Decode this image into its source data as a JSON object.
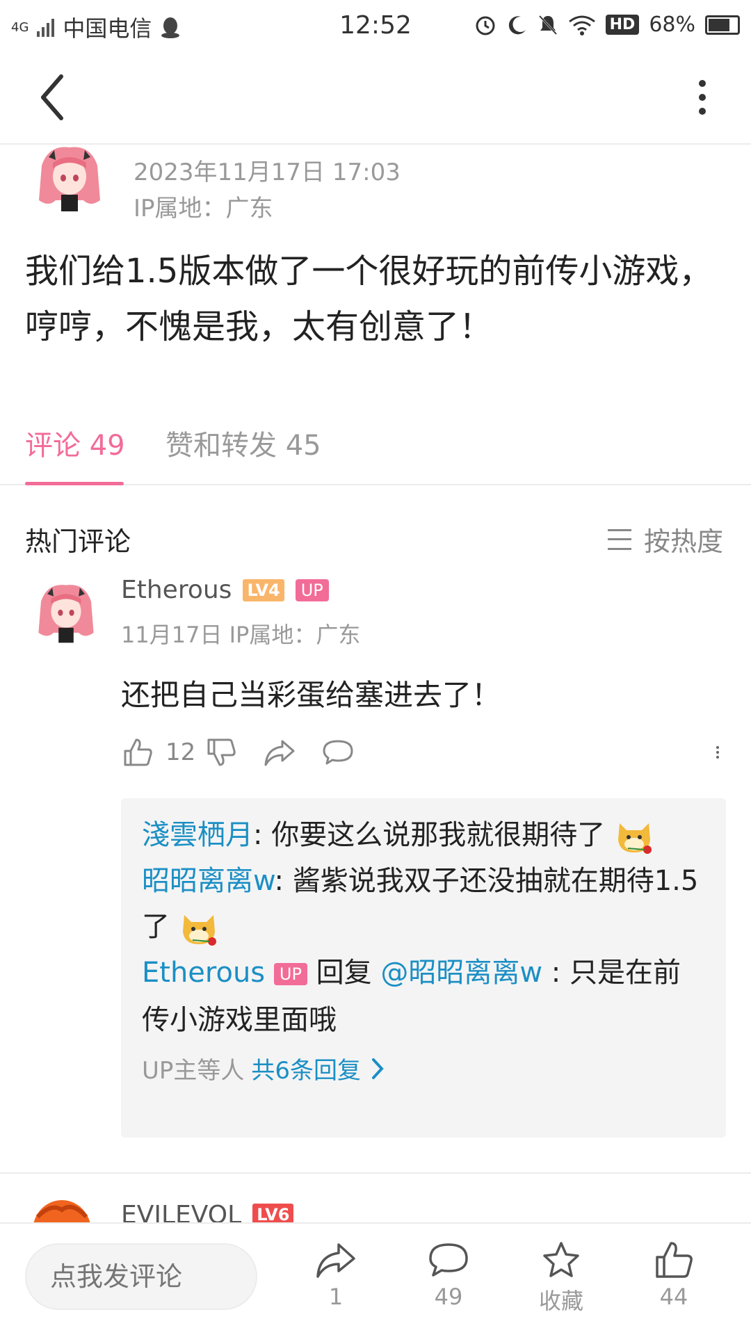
{
  "status_bar": {
    "network": "4G",
    "carrier": "中国电信",
    "time": "12:52",
    "hd": "HD",
    "battery": "68%"
  },
  "post": {
    "timestamp": "2023年11月17日 17:03",
    "ip_location": "IP属地：广东",
    "content": "我们给1.5版本做了一个很好玩的前传小游戏，哼哼，不愧是我，太有创意了！"
  },
  "tabs": [
    {
      "label": "评论 49",
      "active": true
    },
    {
      "label": "赞和转发 45",
      "active": false
    }
  ],
  "comments_header": {
    "title": "热门评论",
    "sort_label": "按热度"
  },
  "comment": {
    "author": "Etherous",
    "level": "LV4",
    "up_badge": "UP",
    "meta": "11月17日  IP属地：广东",
    "text": "还把自己当彩蛋给塞进去了！",
    "likes": "12",
    "replies": [
      {
        "who": "淺雲栖月",
        "text": ": 你要这么说那我就很期待了"
      },
      {
        "who": "昭昭离离w",
        "text": ": 酱紫说我双子还没抽就在期待1.5了"
      },
      {
        "who": "Etherous",
        "badge": "UP",
        "reply_word": "回复",
        "mention": "@昭昭离离w",
        "text": " : 只是在前传小游戏里面哦"
      }
    ],
    "more_prefix": "UP主等人",
    "more_count": "共6条回复"
  },
  "next_comment": {
    "author": "EVILEVOL",
    "level": "LV6"
  },
  "bottom_bar": {
    "input_placeholder": "点我发评论",
    "share_count": "1",
    "comment_count": "49",
    "favorite_label": "收藏",
    "like_count": "44"
  },
  "colors": {
    "accent": "#f26c98",
    "link": "#1b8fc4",
    "muted": "#999999"
  }
}
